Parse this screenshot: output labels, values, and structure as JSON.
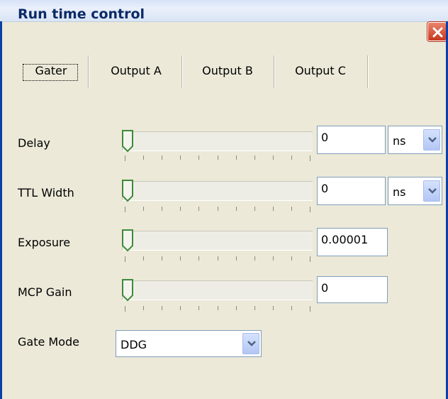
{
  "window": {
    "title": "Run time control"
  },
  "tabs": [
    {
      "label": "Gater",
      "selected": true
    },
    {
      "label": "Output A"
    },
    {
      "label": "Output B"
    },
    {
      "label": "Output C"
    }
  ],
  "rows": [
    {
      "label": "Delay",
      "value": "0",
      "unit": "ns",
      "slider_value": 0
    },
    {
      "label": "TTL Width",
      "value": "0",
      "unit": "ns",
      "slider_value": 0
    },
    {
      "label": "Exposure",
      "value": "0.00001",
      "slider_value": 0
    },
    {
      "label": "MCP Gain",
      "value": "0",
      "slider_value": 0
    }
  ],
  "gate_mode": {
    "label": "Gate Mode",
    "value": "DDG"
  },
  "colors": {
    "title_text": "#0b2a66",
    "close_button": "#d9552f",
    "window_border": "#0d3fa6",
    "face": "#ece9d8"
  }
}
